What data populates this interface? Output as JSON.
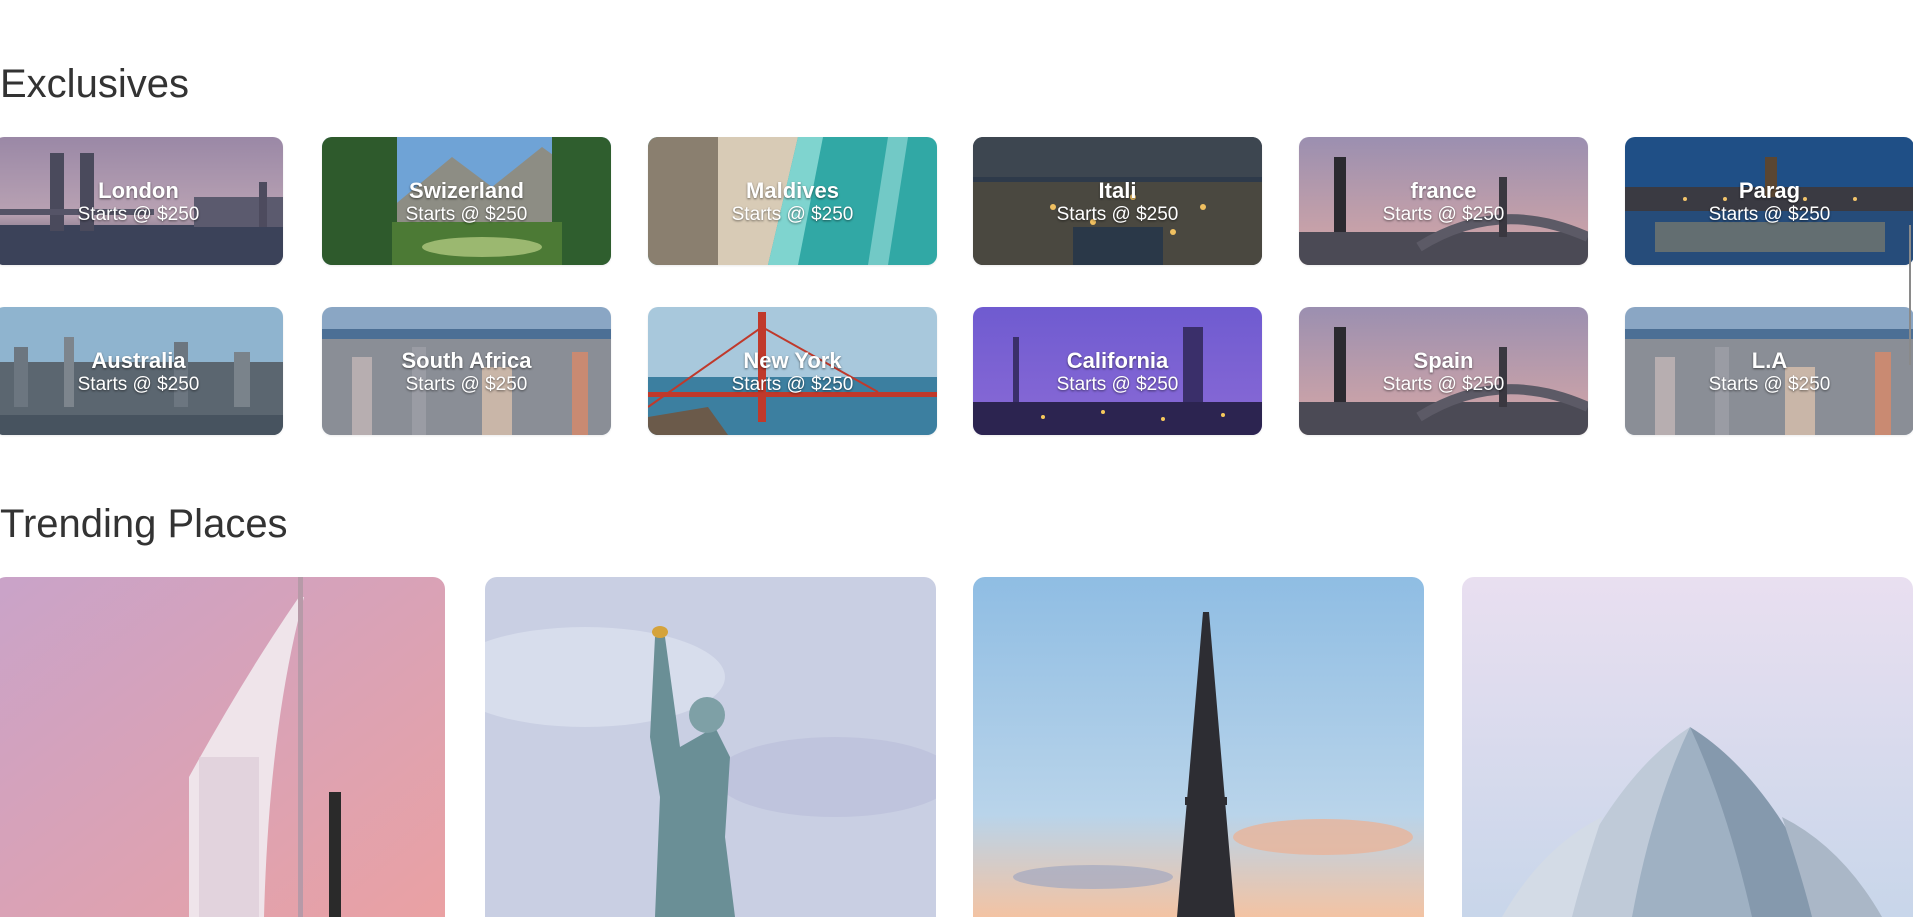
{
  "exclusives": {
    "title": "Exclusives",
    "cards": [
      {
        "name": "London",
        "price": "Starts @ $250"
      },
      {
        "name": "Swizerland",
        "price": "Starts @ $250"
      },
      {
        "name": "Maldives",
        "price": "Starts @ $250"
      },
      {
        "name": "Itali",
        "price": "Starts @ $250"
      },
      {
        "name": "france",
        "price": "Starts @ $250"
      },
      {
        "name": "Parag",
        "price": "Starts @ $250"
      },
      {
        "name": "Australia",
        "price": "Starts @ $250"
      },
      {
        "name": "South Africa",
        "price": "Starts @ $250"
      },
      {
        "name": "New York",
        "price": "Starts @ $250"
      },
      {
        "name": "California",
        "price": "Starts @ $250"
      },
      {
        "name": "Spain",
        "price": "Starts @ $250"
      },
      {
        "name": "L.A",
        "price": "Starts @ $250"
      }
    ]
  },
  "trending": {
    "title": "Trending Places"
  }
}
